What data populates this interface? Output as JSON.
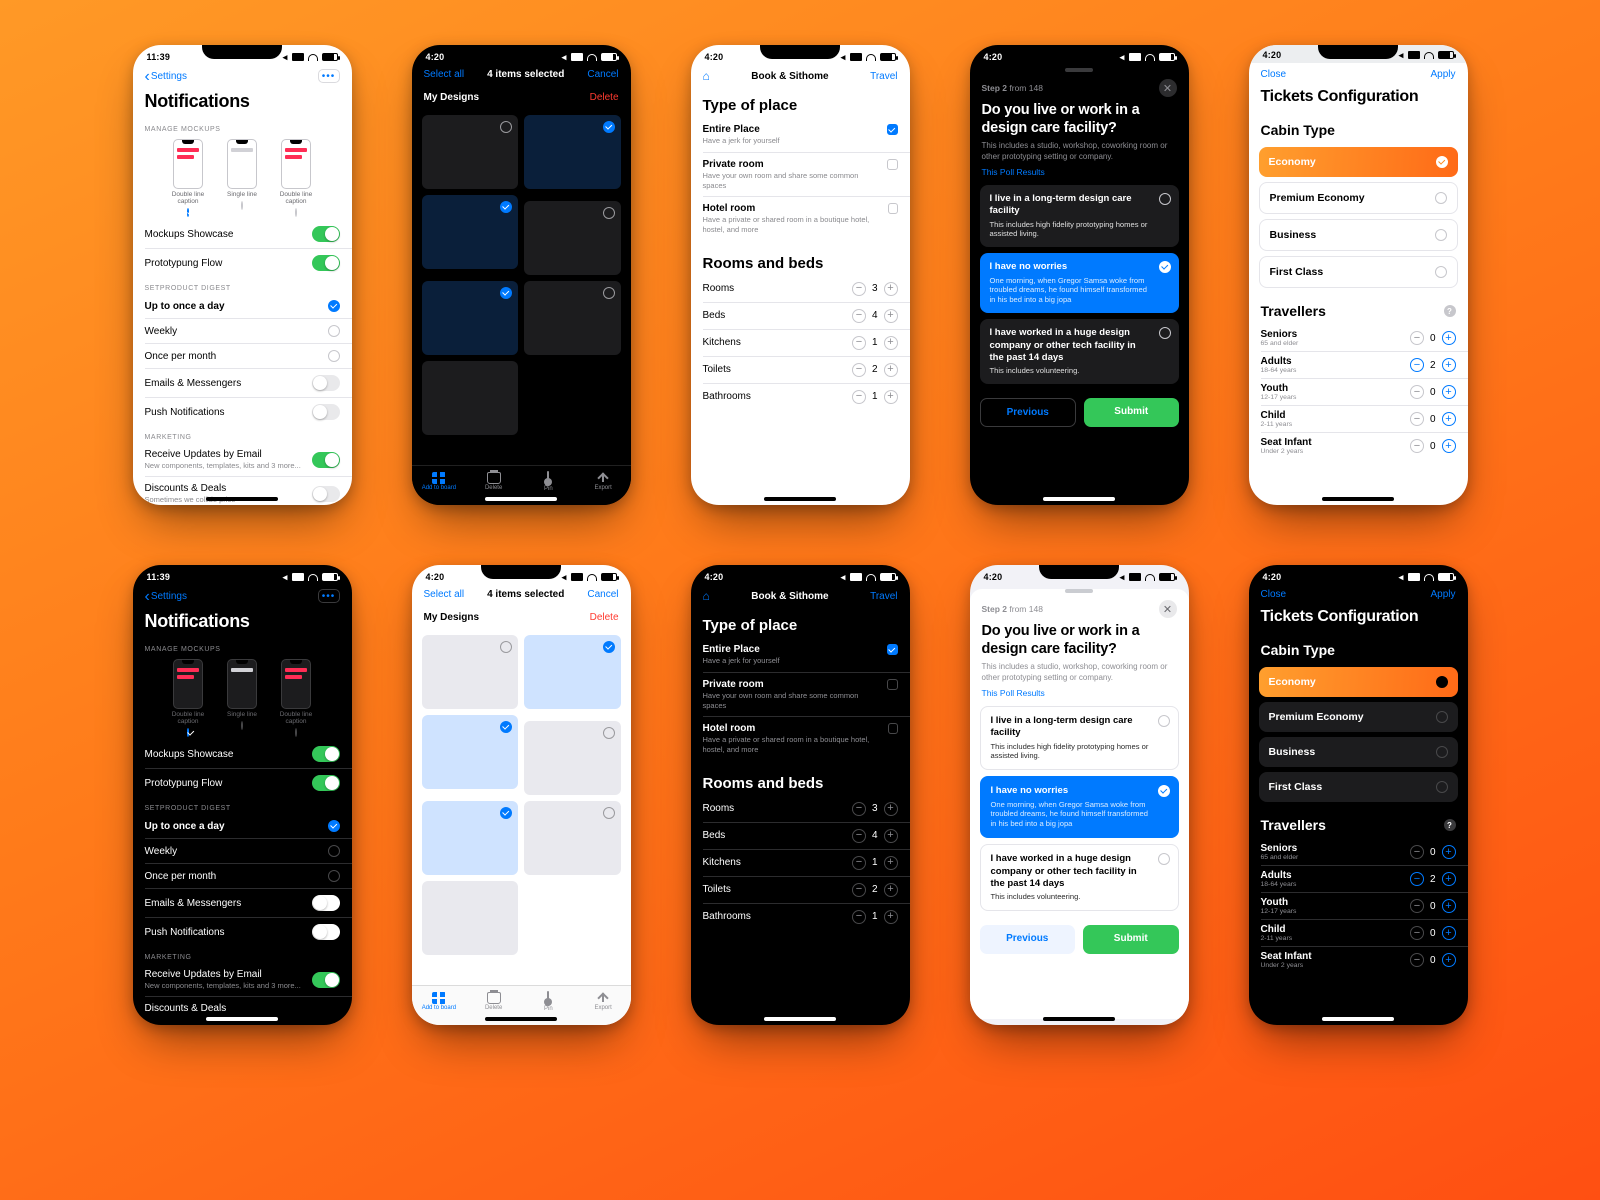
{
  "times": {
    "t1139": "11:39",
    "t420": "4:20"
  },
  "screen1": {
    "back": "Settings",
    "title": "Notifications",
    "sec_mockups": "MANAGE MOCKUPS",
    "mockups": [
      {
        "label": "Double line caption",
        "variant": "pink",
        "checked": true
      },
      {
        "label": "Single line",
        "variant": "plain",
        "checked": false
      },
      {
        "label": "Double line caption",
        "variant": "pink",
        "checked": false
      }
    ],
    "toggles": [
      {
        "label": "Mockups Showcase",
        "on": true
      },
      {
        "label": "Prototypung Flow",
        "on": true
      }
    ],
    "sec_digest": "SETPRODUCT DIGEST",
    "digest": [
      {
        "label": "Up to once a day",
        "on": true
      },
      {
        "label": "Weekly",
        "on": false
      },
      {
        "label": "Once per month",
        "on": false
      }
    ],
    "delivery": [
      {
        "label": "Emails & Messengers",
        "on": false
      },
      {
        "label": "Push Notifications",
        "on": false
      }
    ],
    "sec_marketing": "MARKETING",
    "marketing": [
      {
        "label": "Receive Updates by Email",
        "sub": "New components, templates, kits and 3 more...",
        "on": true
      },
      {
        "label": "Discounts & Deals",
        "sub": "Sometimes we collide price",
        "on": false
      }
    ]
  },
  "screen2": {
    "select_all": "Select all",
    "selected": "4 items selected",
    "cancel": "Cancel",
    "section": "My Designs",
    "delete": "Delete",
    "tiles": [
      {
        "sel": false
      },
      {
        "sel": true
      },
      {
        "sel": true
      },
      {
        "sel": false
      },
      {
        "sel": true
      },
      {
        "sel": false
      }
    ],
    "tabs": [
      {
        "label": "Add to board",
        "icon": "grid",
        "on": true
      },
      {
        "label": "Delete",
        "icon": "trash",
        "on": false
      },
      {
        "label": "Pin",
        "icon": "pin",
        "on": false
      },
      {
        "label": "Export",
        "icon": "up",
        "on": false
      }
    ]
  },
  "screen3": {
    "app": "Book & Sithome",
    "action": "Travel",
    "h_place": "Type of place",
    "places": [
      {
        "t": "Entire Place",
        "d": "Have a jerk for yourself",
        "on": true
      },
      {
        "t": "Private room",
        "d": "Have your own room and share some common spaces",
        "on": false
      },
      {
        "t": "Hotel room",
        "d": "Have a private or shared room in a boutique hotel, hostel, and more",
        "on": false
      }
    ],
    "h_rooms": "Rooms and beds",
    "rooms": [
      {
        "t": "Rooms",
        "v": 3
      },
      {
        "t": "Beds",
        "v": 4
      },
      {
        "t": "Kitchens",
        "v": 1
      },
      {
        "t": "Toilets",
        "v": 2
      },
      {
        "t": "Bathrooms",
        "v": 1
      }
    ]
  },
  "screen4": {
    "step_label": "Step 2",
    "step_of": "from 148",
    "h": "Do you live or work in a design care facility?",
    "sub": "This includes a studio, workshop, coworking room or other prototyping setting or company.",
    "link": "This Poll Results",
    "opts": [
      {
        "t": "I live in a long-term design care facility",
        "d": "This includes high fidelity prototyping homes or assisted living.",
        "sel": false
      },
      {
        "t": "I have no worries",
        "d": "One morning, when Gregor Samsa woke from troubled dreams, he found himself transformed in his bed into a big jopa",
        "sel": true
      },
      {
        "t": "I have  worked in a huge design company or other tech facility in the past 14 days",
        "d": "This includes volunteering.",
        "sel": false
      }
    ],
    "prev": "Previous",
    "submit": "Submit"
  },
  "screen5": {
    "close": "Close",
    "apply": "Apply",
    "title": "Tickets Configuration",
    "h_cabin": "Cabin Type",
    "cabins": [
      {
        "t": "Economy",
        "sel": true
      },
      {
        "t": "Premium Economy",
        "sel": false
      },
      {
        "t": "Business",
        "sel": false
      },
      {
        "t": "First Class",
        "sel": false
      }
    ],
    "h_trav": "Travellers",
    "trav": [
      {
        "t": "Seniors",
        "a": "65 and elder",
        "v": 0
      },
      {
        "t": "Adults",
        "a": "18-64 years",
        "v": 2
      },
      {
        "t": "Youth",
        "a": "12-17 years",
        "v": 0
      },
      {
        "t": "Child",
        "a": "2-11 years",
        "v": 0
      },
      {
        "t": "Seat Infant",
        "a": "Under 2 years",
        "v": 0
      }
    ]
  }
}
